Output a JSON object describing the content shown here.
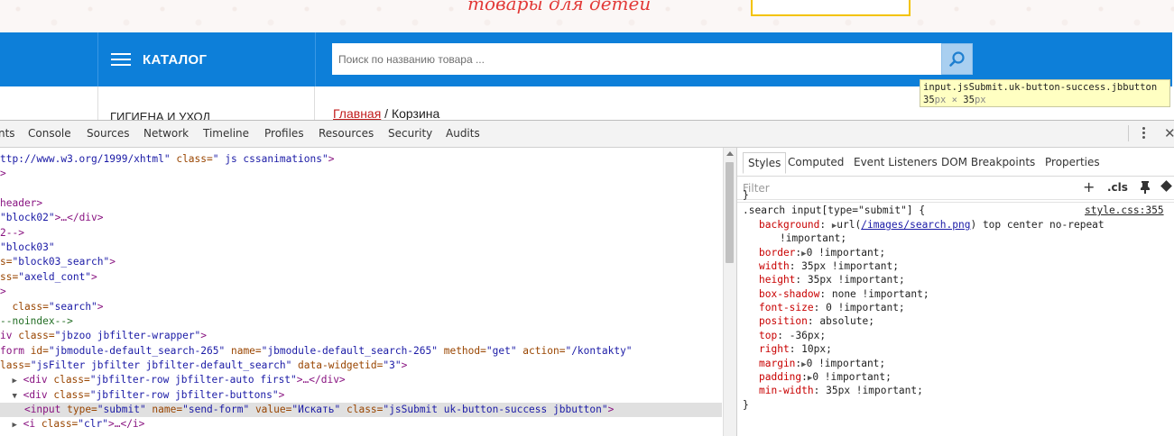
{
  "site": {
    "slogan": "товары для детей",
    "catalog_label": "КАТАЛОГ",
    "search_placeholder": "Поиск по названию товара ...",
    "sidebar_item": "ГИГИЕНА И УХОД",
    "breadcrumb_home": "Главная",
    "breadcrumb_sep": " / ",
    "breadcrumb_current": "Корзина",
    "colors": {
      "bar": "#0d7fd9",
      "accent": "#e23a38",
      "promo_border": "#f3c300"
    }
  },
  "tooltip": {
    "selector": "input.jsSubmit.uk-button-success.jbbutton",
    "width": "35",
    "height": "35",
    "unit": "px",
    "times": " × "
  },
  "devtools": {
    "tabs": [
      "nts",
      "Console",
      "Sources",
      "Network",
      "Timeline",
      "Profiles",
      "Resources",
      "Security",
      "Audits"
    ],
    "elements": [
      {
        "t": "ttp://www.w3.org/1999/xhtml\"",
        "a": " class=",
        "v": "\" js cssanimations\"",
        "e": ">"
      },
      {
        "raw": ">"
      },
      {
        "raw": ""
      },
      {
        "raw": "header>"
      },
      {
        "pre": "\"block02\"",
        "e": ">…</div>"
      },
      {
        "raw": "2-->"
      },
      {
        "pre": "\"block03\""
      },
      {
        "pre2": "s=",
        "v": "\"block03_search\"",
        "e": ">"
      },
      {
        "pre2": "ss=",
        "v": "\"axeld_cont\"",
        "e": ">"
      },
      {
        "raw": ">"
      },
      {
        "tg": " class=",
        "v": "\"search\"",
        "e": ">"
      },
      {
        "cm": "--noindex-->"
      },
      {
        "div": "iv class=",
        "v": "\"jbzoo jbfilter-wrapper\"",
        "e": ">"
      },
      {
        "form": "form id=",
        "v1": "\"jbmodule-default_search-265\"",
        "a2": " name=",
        "v2": "\"jbmodule-default_search-265\"",
        "a3": " method=",
        "v3": "\"get\"",
        "a4": " action=",
        "v4": "\"/kontakty\""
      },
      {
        "cls": "lass=",
        "v1": "\"jsFilter jbfilter jbfilter-default_search\"",
        "a2": " data-widgetid=",
        "v2": "\"3\"",
        "e": ">"
      },
      {
        "row": "▶",
        "tg": "<div class=",
        "v": "\"jbfilter-row jbfilter-auto first\"",
        "e": ">…</div>"
      },
      {
        "row": "▼",
        "tg": "<div class=",
        "v": "\"jbfilter-row jbfilter-buttons\"",
        "e": ">"
      },
      {
        "sel": true
      },
      {
        "row": "▶",
        "tg": "<i class=",
        "v": "\"clr\"",
        "e": ">…</i>"
      }
    ],
    "selected_line": {
      "tag_open": "<input",
      "attrs": [
        {
          "name": " type=",
          "value": "\"submit\""
        },
        {
          "name": " name=",
          "value": "\"send-form\""
        },
        {
          "name": " value=",
          "value": "\"Искать\""
        },
        {
          "name": " class=",
          "value": "\"jsSubmit uk-button-success jbbutton\""
        }
      ],
      "tag_close": ">"
    },
    "styles_tabs": [
      "Styles",
      "Computed",
      "Event Listeners",
      "DOM Breakpoints",
      "Properties"
    ],
    "filter_placeholder": "Filter",
    "cls_label": ".cls",
    "plus_label": "+",
    "prev_rule_close": "}",
    "rule": {
      "selector": ".search input[type=\"submit\"] {",
      "source": "style.css:355",
      "declarations": [
        {
          "prop": "background",
          "colon": ": ",
          "tri": "▶",
          "pre": "url(",
          "link": "/images/search.png",
          "post": ") top center no-repeat"
        },
        {
          "cont": "!important;"
        },
        {
          "prop": "border",
          "colon": ":",
          "tri": "▶",
          "pre": "0 !important;"
        },
        {
          "prop": "width",
          "colon": ": ",
          "pre": "35px !important;"
        },
        {
          "prop": "height",
          "colon": ": ",
          "pre": "35px !important;"
        },
        {
          "prop": "box-shadow",
          "colon": ": ",
          "pre": "none !important;"
        },
        {
          "prop": "font-size",
          "colon": ": ",
          "pre": "0 !important;"
        },
        {
          "prop": "position",
          "colon": ": ",
          "pre": "absolute;"
        },
        {
          "prop": "top",
          "colon": ": ",
          "pre": "-36px;"
        },
        {
          "prop": "right",
          "colon": ": ",
          "pre": "10px;"
        },
        {
          "prop": "margin",
          "colon": ":",
          "tri": "▶",
          "pre": "0 !important;"
        },
        {
          "prop": "padding",
          "colon": ":",
          "tri": "▶",
          "pre": "0 !important;"
        },
        {
          "prop": "min-width",
          "colon": ": ",
          "pre": "35px !important;"
        }
      ],
      "close": "}"
    }
  }
}
